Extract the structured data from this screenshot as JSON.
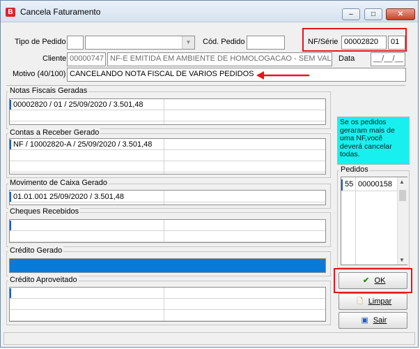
{
  "window": {
    "title": "Cancela Faturamento",
    "app_icon_letter": "B",
    "controls": {
      "minimize": "–",
      "maximize": "□",
      "close": "✕"
    }
  },
  "header": {
    "tipo_pedido_label": "Tipo de Pedido",
    "tipo_pedido_code": "",
    "tipo_pedido_value": "",
    "cod_pedido_label": "Cód. Pedido",
    "cod_pedido_value": "",
    "nf_serie_label": "NF/Série",
    "nf_value": "00002820",
    "serie_value": "01",
    "cliente_label": "Cliente",
    "cliente_code": "00000747",
    "cliente_name": "NF-E EMITIDA EM AMBIENTE DE HOMOLOGACAO - SEM VALOR",
    "data_label": "Data",
    "data_value": "__/__/__",
    "motivo_label": "Motivo (40/100)",
    "motivo_value": "CANCELANDO NOTA FISCAL DE VARIOS PEDIDOS"
  },
  "sections": {
    "notas": {
      "title": "Notas Fiscais Geradas",
      "rows": [
        "00002820 / 01 / 25/09/2020 / 3.501,48"
      ]
    },
    "contas": {
      "title": "Contas a Receber Gerado",
      "rows": [
        "NF / 10002820-A      / 25/09/2020 / 3.501,48"
      ]
    },
    "caixa": {
      "title": "Movimento de Caixa Gerado",
      "rows": [
        "01.01.001 25/09/2020 / 3.501,48"
      ]
    },
    "cheques": {
      "title": "Cheques Recebidos",
      "rows": []
    },
    "credito_gerado": {
      "title": "Crédito Gerado"
    },
    "credito_aproveitado": {
      "title": "Crédito Aproveitado",
      "rows": []
    }
  },
  "info_text": "Se os pedidos geraram mais de uma NF,você deverá cancelar todas.",
  "pedidos": {
    "title": "Pedidos",
    "rows": [
      {
        "seq": "55",
        "numero": "00000158"
      }
    ]
  },
  "buttons": {
    "ok": "OK",
    "limpar": "Limpar",
    "sair": "Sair"
  },
  "colors": {
    "accent_red": "#e8141c",
    "info_bg": "#18f0f0",
    "credit_bar": "#0a7ad8",
    "selection": "#1e5cc6"
  }
}
